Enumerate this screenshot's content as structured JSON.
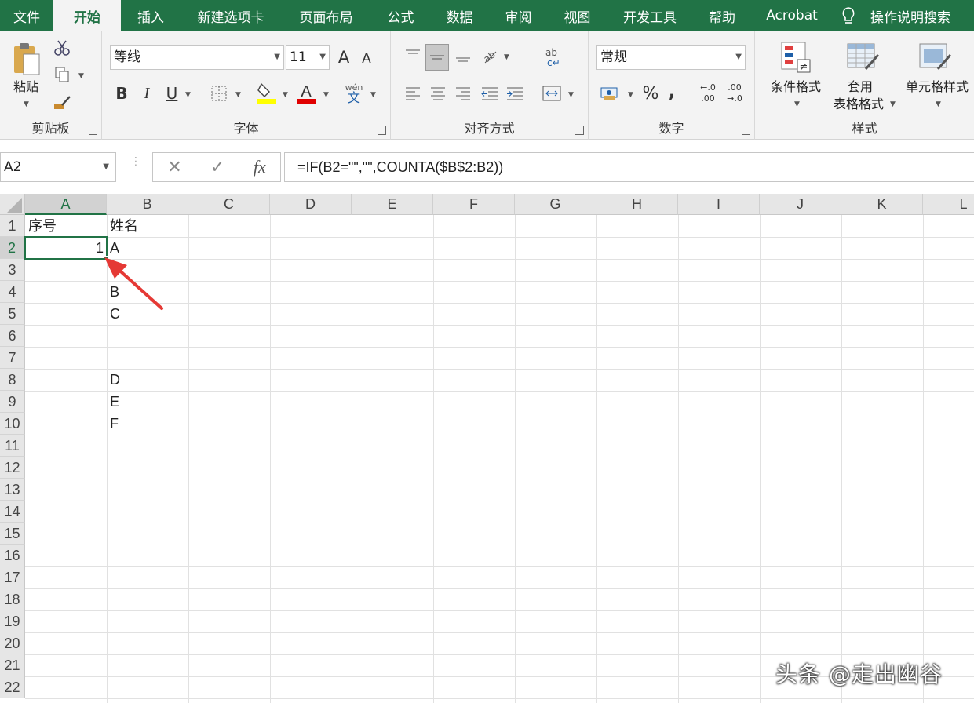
{
  "menu": {
    "tabs": [
      "文件",
      "开始",
      "插入",
      "新建选项卡",
      "页面布局",
      "公式",
      "数据",
      "审阅",
      "视图",
      "开发工具",
      "帮助",
      "Acrobat"
    ],
    "active_tab": "开始",
    "tell_me": "操作说明搜索"
  },
  "ribbon": {
    "clipboard": {
      "paste_label": "粘贴",
      "group_label": "剪贴板"
    },
    "font": {
      "font_name": "等线",
      "font_size": "11",
      "group_label": "字体",
      "bold": "B",
      "italic": "I",
      "underline": "U",
      "grow": "A",
      "shrink": "A",
      "font_color_glyph": "A",
      "wen_top": "wén",
      "wen_bottom": "文"
    },
    "alignment": {
      "group_label": "对齐方式"
    },
    "number": {
      "format": "常规",
      "group_label": "数字",
      "percent": "%",
      "comma": ",",
      "inc_decimal_top": "←.0",
      "inc_decimal_bottom": ".00",
      "dec_decimal_top": ".00",
      "dec_decimal_bottom": "→.0"
    },
    "styles": {
      "conditional": "条件格式",
      "table_format_1": "套用",
      "table_format_2": "表格格式",
      "cell_styles": "单元格样式",
      "group_label": "样式"
    }
  },
  "formula_bar": {
    "name_box": "A2",
    "formula": "=IF(B2=\"\",\"\",COUNTA($B$2:B2))",
    "fx": "fx"
  },
  "sheet": {
    "columns": [
      "A",
      "B",
      "C",
      "D",
      "E",
      "F",
      "G",
      "H",
      "I",
      "J",
      "K",
      "L"
    ],
    "rows": [
      "1",
      "2",
      "3",
      "4",
      "5",
      "6",
      "7",
      "8",
      "9",
      "10",
      "11",
      "12",
      "13",
      "14",
      "15",
      "16",
      "17",
      "18",
      "19",
      "20",
      "21",
      "22"
    ],
    "selected_cell": "A2",
    "cells": {
      "A1": "序号",
      "B1": "姓名",
      "A2": "1",
      "B2": "A",
      "B4": "B",
      "B5": "C",
      "B8": "D",
      "B9": "E",
      "B10": "F"
    }
  },
  "watermark": "头条 @走出幽谷",
  "colors": {
    "accent": "#217346",
    "arrow": "#e53935"
  }
}
